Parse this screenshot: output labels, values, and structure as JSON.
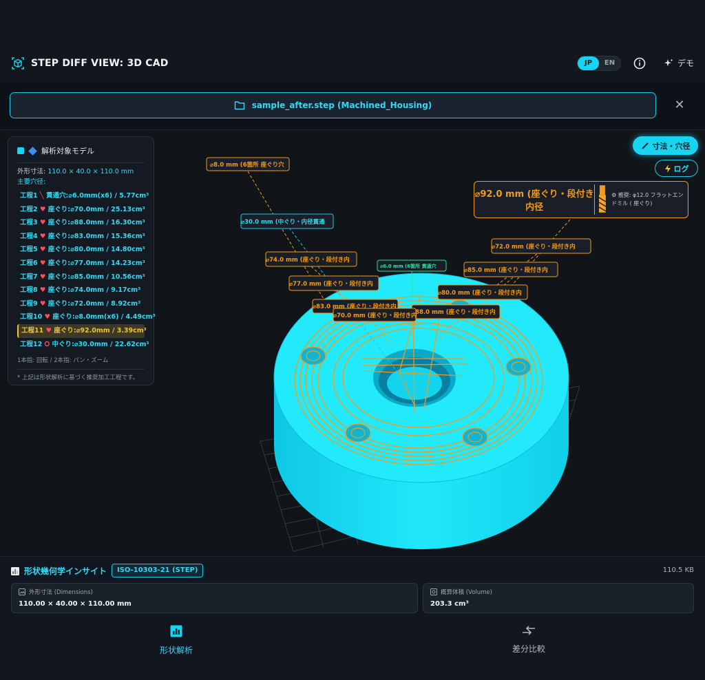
{
  "app": {
    "title": "STEP DIFF VIEW: 3D CAD",
    "lang_jp": "JP",
    "lang_en": "EN",
    "demo_label": "デモ"
  },
  "file": {
    "label": "sample_after.step (Machined_Housing)"
  },
  "panel": {
    "header": "解析対象モデル",
    "size_label": "外形寸法: ",
    "size_value": "110.0 × 40.0 × 110.0 mm",
    "holes_label": "主要穴径:",
    "processes": [
      {
        "num": "工程1",
        "icon": "drill",
        "text": "貫通穴:⌀6.0mm(x6) / 5.77cm³",
        "selected": false
      },
      {
        "num": "工程2",
        "icon": "heart",
        "text": "座ぐり:⌀70.0mm / 25.13cm³",
        "selected": false
      },
      {
        "num": "工程3",
        "icon": "heart",
        "text": "座ぐり:⌀88.0mm / 16.30cm³",
        "selected": false
      },
      {
        "num": "工程4",
        "icon": "heart",
        "text": "座ぐり:⌀83.0mm / 15.36cm³",
        "selected": false
      },
      {
        "num": "工程5",
        "icon": "heart",
        "text": "座ぐり:⌀80.0mm / 14.80cm³",
        "selected": false
      },
      {
        "num": "工程6",
        "icon": "heart",
        "text": "座ぐり:⌀77.0mm / 14.23cm³",
        "selected": false
      },
      {
        "num": "工程7",
        "icon": "heart",
        "text": "座ぐり:⌀85.0mm / 10.56cm³",
        "selected": false
      },
      {
        "num": "工程8",
        "icon": "heart",
        "text": "座ぐり:⌀74.0mm / 9.17cm³",
        "selected": false
      },
      {
        "num": "工程9",
        "icon": "heart",
        "text": "座ぐり:⌀72.0mm / 8.92cm³",
        "selected": false
      },
      {
        "num": "工程10",
        "icon": "heart",
        "text": "座ぐり:⌀8.0mm(x6) / 4.49cm³",
        "selected": false
      },
      {
        "num": "工程11",
        "icon": "heart",
        "text": "座ぐり:⌀92.0mm / 3.39cm³",
        "selected": true
      },
      {
        "num": "工程12",
        "icon": "ring",
        "text": "中ぐり:⌀30.0mm / 22.62cm³",
        "selected": false
      }
    ],
    "gesture_note": "1本指: 回転 / 2本指: パン・ズーム",
    "footnote": "* 上記は形状解析に基づく推奨加工工程です。"
  },
  "viewport": {
    "dim_button": "寸法・穴径",
    "log_button": "ログ",
    "callout_main": "⌀92.0 mm (座ぐり・段付き内径",
    "callout_rec": "推奨: φ12.0 フラットエンドミル ( 座ぐり)",
    "labels": [
      "⌀8.0 mm (6箇所 座ぐり穴",
      "⌀30.0 mm (中ぐり・内径貫通",
      "⌀74.0 mm (座ぐり・段付き内",
      "⌀6.0 mm (6箇所 貫通穴",
      "⌀77.0 mm (座ぐり・段付き内",
      "⌀72.0 mm (座ぐり・段付き内",
      "⌀85.0 mm (座ぐり・段付き内",
      "⌀80.0 mm (座ぐり・段付き内",
      "⌀83.0 mm (座ぐり・段付き内",
      "⌀88.0 mm (座ぐり・段付き内",
      "⌀70.0 mm (座ぐり・段付き内"
    ]
  },
  "insight": {
    "title": "形状幾何学インサイト",
    "badge": "ISO-10303-21 (STEP)",
    "file_size": "110.5 KB",
    "dims_label": "外形寸法 (Dimensions)",
    "dims_value": "110.00 × 40.00 × 110.00 mm",
    "vol_label": "概算体積 (Volume)",
    "vol_value": "203.3 cm³"
  },
  "nav": {
    "analysis": "形状解析",
    "diff": "差分比較"
  },
  "colors": {
    "accent": "#19d4f0",
    "part": "#14e0f5",
    "annotation": "#f29a1a",
    "bg": "#0e1218"
  }
}
